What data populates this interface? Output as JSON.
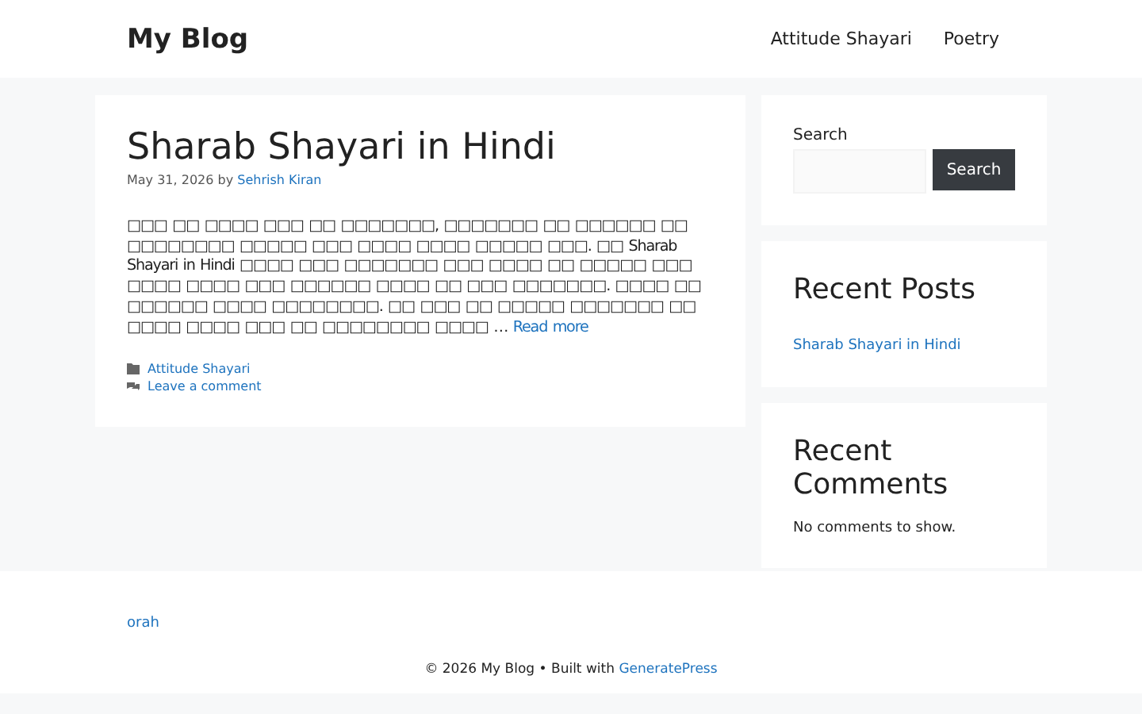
{
  "site_title": "My Blog",
  "nav": [
    {
      "label": "Attitude Shayari"
    },
    {
      "label": "Poetry"
    }
  ],
  "post": {
    "title": "Sharab Shayari in Hindi",
    "date": "May 31, 2026",
    "by": "by",
    "author": "Sehrish Kiran",
    "excerpt": "□□□ □□ □□□□ □□□ □□ □□□□□□□, □□□□□□□ □□ □□□□□□ □□ □□□□□□□□ □□□□□ □□□ □□□□ □□□□ □□□□□ □□□. □□ Sharab Shayari in Hindi □□□□ □□□ □□□□□□□ □□□ □□□□ □□ □□□□□ □□□ □□□□ □□□□ □□□ □□□□□□ □□□□ □□ □□□ □□□□□□□. □□□□ □□ □□□□□□ □□□□ □□□□□□□□. □□ □□□ □□ □□□□□ □□□□□□□ □□ □□□□ □□□□ □□□ □□ □□□□□□□□ □□□□ …",
    "read_more": "Read more",
    "category": "Attitude Shayari",
    "comment_link": "Leave a comment"
  },
  "sidebar": {
    "search_label": "Search",
    "search_button": "Search",
    "recent_posts_title": "Recent Posts",
    "recent_posts": [
      "Sharab Shayari in Hindi"
    ],
    "recent_comments_title": "Recent Comments",
    "no_comments": "No comments to show."
  },
  "footer_widget_link": "orah",
  "footer": {
    "copyright": "© 2026 My Blog • Built with",
    "theme_link": "GeneratePress"
  }
}
